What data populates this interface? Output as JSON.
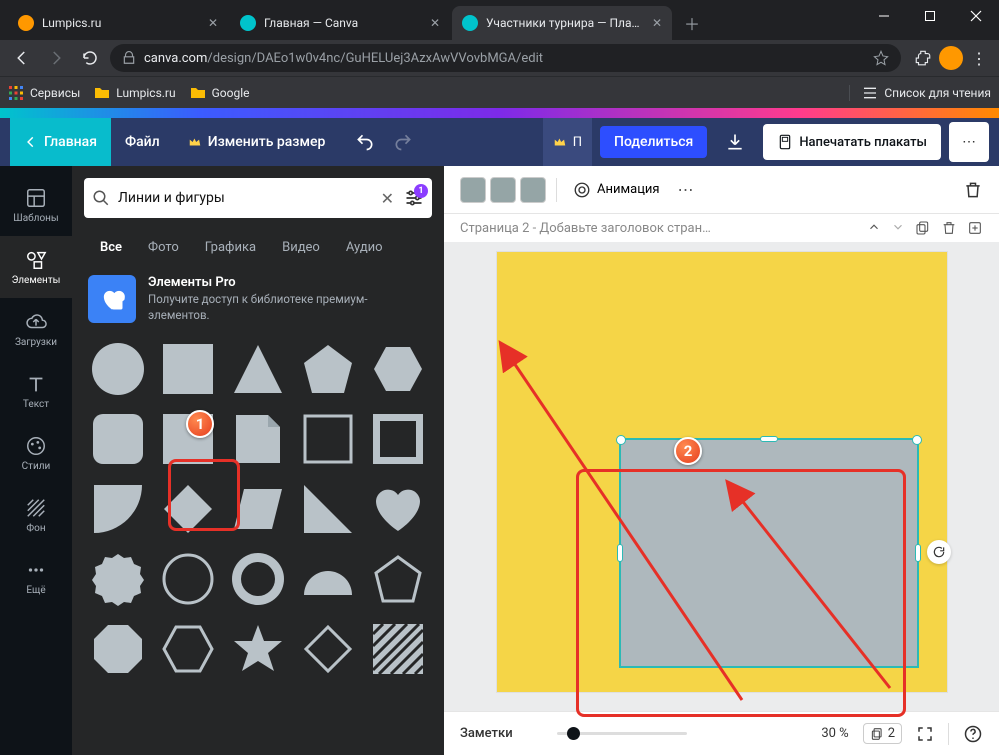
{
  "window": {
    "min": "—",
    "max": "□",
    "close": "✕"
  },
  "tabs": [
    {
      "title": "Lumpics.ru",
      "favicon": "#ff9800"
    },
    {
      "title": "Главная — Canva",
      "favicon": "#00c4cc"
    },
    {
      "title": "Участники турнира — Плакат",
      "favicon": "#00c4cc",
      "active": true
    }
  ],
  "url": {
    "host": "canva.com",
    "path": "/design/DAEo1w0v4nc/GuHELUej3AzxAwVVovbMGA/edit"
  },
  "bookmarks": {
    "services": "Сервисы",
    "lumpics": "Lumpics.ru",
    "google": "Google",
    "reading": "Список для чтения"
  },
  "canva_bar": {
    "home": "Главная",
    "file": "Файл",
    "resize": "Изменить размер",
    "pro_short": "П",
    "share": "Поделиться",
    "print": "Напечатать плакаты"
  },
  "rail": {
    "templates": "Шаблоны",
    "elements": "Элементы",
    "uploads": "Загрузки",
    "text": "Текст",
    "styles": "Стили",
    "background": "Фон",
    "more": "Ещё"
  },
  "search": {
    "placeholder": "",
    "value": "Линии и фигуры",
    "badge": "1"
  },
  "cats": {
    "all": "Все",
    "photo": "Фото",
    "graphics": "Графика",
    "video": "Видео",
    "audio": "Аудио"
  },
  "pro": {
    "title": "Элементы Pro",
    "sub": "Получите доступ к библиотеке премиум-элементов."
  },
  "tools": {
    "animation": "Анимация"
  },
  "page": {
    "label": "Страница 2 - Добавьте заголовок стран…"
  },
  "footer": {
    "notes": "Заметки",
    "zoom": "30 %",
    "pages": "2"
  },
  "anno": {
    "badge1": "1",
    "badge2": "2"
  }
}
